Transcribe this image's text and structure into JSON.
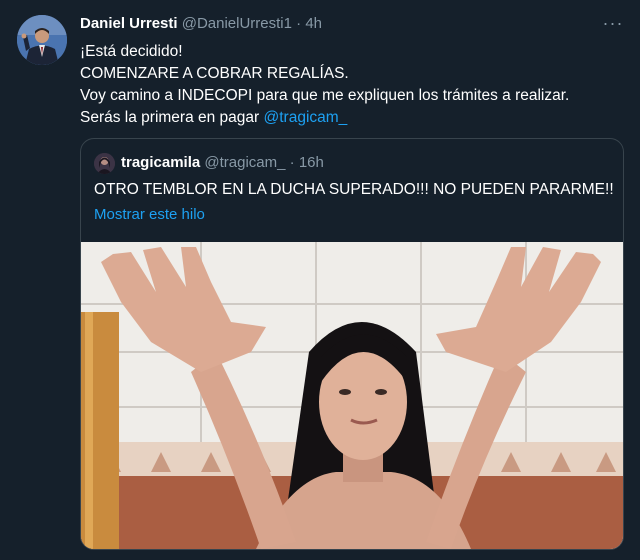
{
  "tweet": {
    "display_name": "Daniel Urresti",
    "handle": "@DanielUrresti1",
    "separator": "·",
    "time": "4h",
    "lines": [
      "¡Está decidido!",
      "COMENZARE A COBRAR REGALÍAS.",
      "Voy camino a INDECOPI para que me expliquen los trámites a realizar."
    ],
    "last_line_prefix": "Serás la primera en pagar ",
    "mention": "@tragicam_",
    "more_label": "···"
  },
  "quote": {
    "display_name": "tragicamila",
    "handle": "@tragicam_",
    "separator": "·",
    "time": "16h",
    "text": "OTRO TEMBLOR EN LA DUCHA SUPERADO!!! NO PUEDEN PARARME!!",
    "show_thread": "Mostrar este hilo"
  },
  "colors": {
    "background": "#15202b",
    "accent": "#1da1f2",
    "muted": "#8899a6",
    "border": "#38444d"
  }
}
